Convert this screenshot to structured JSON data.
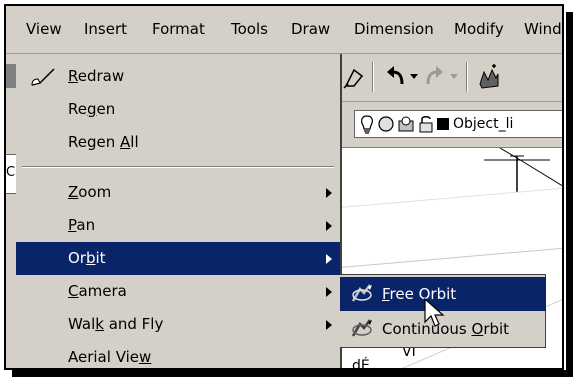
{
  "menubar": {
    "items": [
      "View",
      "Insert",
      "Format",
      "Tools",
      "Draw",
      "Dimension",
      "Modify",
      "Wind"
    ]
  },
  "layer_toolbar": {
    "layer_name": "Object_li"
  },
  "left_clip": {
    "text": "C"
  },
  "view_menu": {
    "items": [
      {
        "label_pre": "",
        "label_u": "R",
        "label_post": "edraw",
        "has_submenu": false
      },
      {
        "label_pre": "Re",
        "label_u": "g",
        "label_post": "en",
        "has_submenu": false
      },
      {
        "label_pre": "Regen ",
        "label_u": "A",
        "label_post": "ll",
        "has_submenu": false
      },
      {
        "label_pre": "",
        "label_u": "Z",
        "label_post": "oom",
        "has_submenu": true
      },
      {
        "label_pre": "",
        "label_u": "P",
        "label_post": "an",
        "has_submenu": true
      },
      {
        "label_pre": "Or",
        "label_u": "b",
        "label_post": "it",
        "has_submenu": true,
        "highlighted": true
      },
      {
        "label_pre": "",
        "label_u": "C",
        "label_post": "amera",
        "has_submenu": true
      },
      {
        "label_pre": "Wal",
        "label_u": "k",
        "label_post": " and Fly",
        "has_submenu": true
      },
      {
        "label_pre": "Aerial Vie",
        "label_u": "w",
        "label_post": "",
        "has_submenu": false
      }
    ]
  },
  "orbit_submenu": {
    "items": [
      {
        "label_pre": "",
        "label_u": "F",
        "label_post": "ree Orbit",
        "highlighted": true
      },
      {
        "label_pre": "Continuous ",
        "label_u": "O",
        "label_post": "rbit",
        "highlighted": false
      }
    ]
  },
  "drawing": {
    "partial_text": "VÎ",
    "partial_text2": "dÉ"
  },
  "colors": {
    "menu_bg": "#d4d0c8",
    "highlight": "#0a246a",
    "highlight_text": "#ffffff"
  }
}
